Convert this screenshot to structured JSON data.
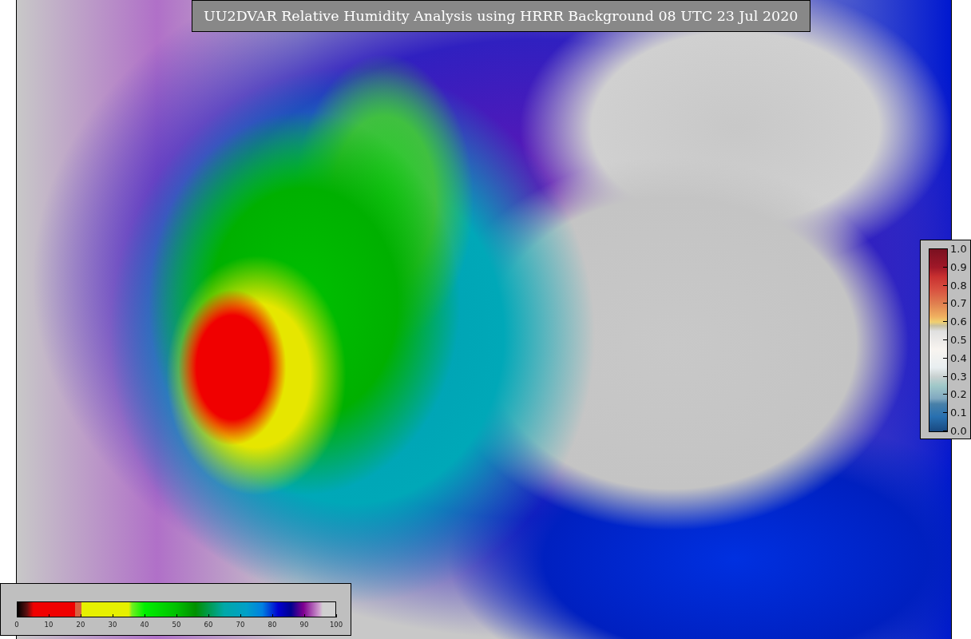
{
  "title": "UU2DVAR Relative Humidity Analysis using HRRR Background 08 UTC 23 Jul 2020",
  "humidity_legend": {
    "ticks": [
      "0",
      "10",
      "20",
      "30",
      "40",
      "50",
      "60",
      "70",
      "80",
      "90",
      "100"
    ]
  },
  "station_legend": {
    "ticks": [
      "1.0",
      "0.9",
      "0.8",
      "0.7",
      "0.6",
      "0.5",
      "0.4",
      "0.3",
      "0.2",
      "0.1",
      "0.0"
    ]
  }
}
